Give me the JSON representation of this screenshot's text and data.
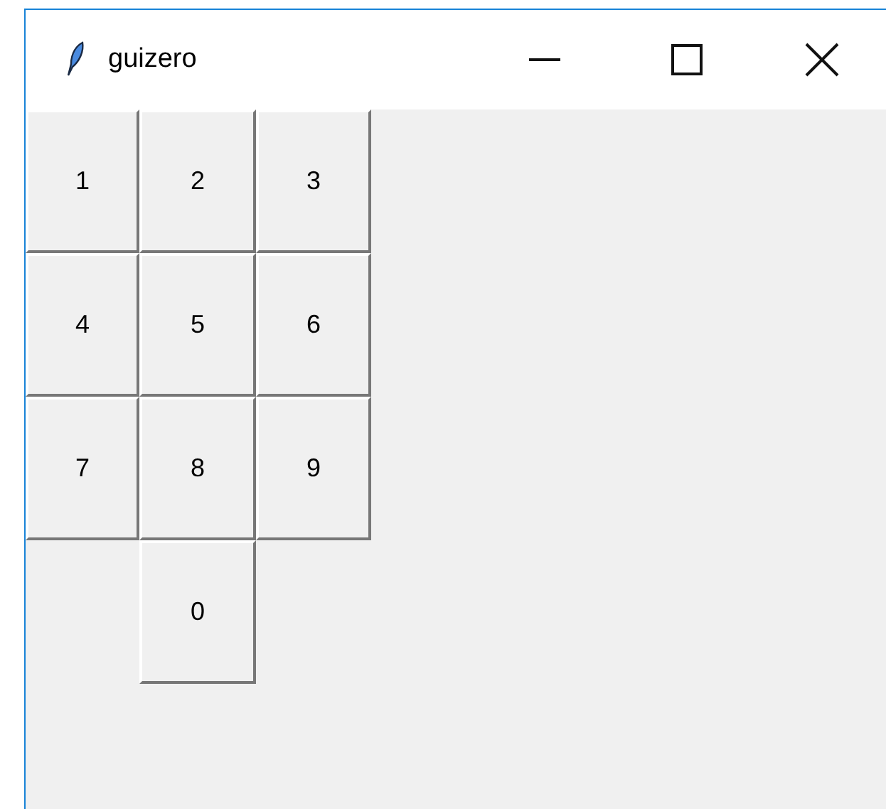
{
  "window": {
    "title": "guizero"
  },
  "keypad": {
    "rows": [
      {
        "keys": [
          "1",
          "2",
          "3"
        ]
      },
      {
        "keys": [
          "4",
          "5",
          "6"
        ]
      },
      {
        "keys": [
          "7",
          "8",
          "9"
        ]
      },
      {
        "keys": [
          "0"
        ]
      }
    ]
  }
}
